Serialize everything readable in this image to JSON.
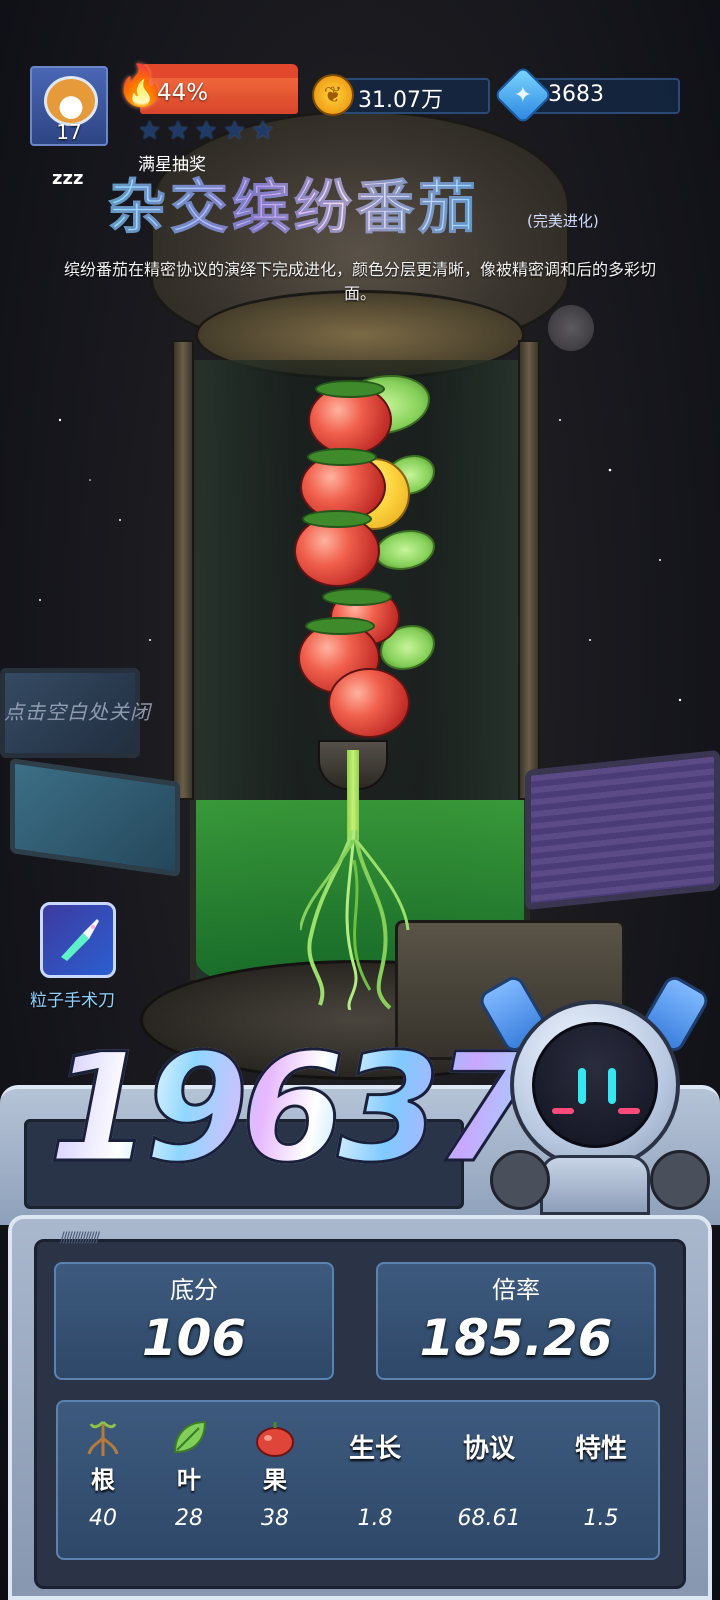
{
  "hud": {
    "avatar_level": "17",
    "status": "zzz",
    "energy_percent": "44%",
    "stars_filled": 0,
    "stars_total": 5,
    "coins": "31.07万",
    "gems": "3683",
    "icons": {
      "energy": "flame-icon",
      "coin": "coin-icon",
      "gem": "gem-icon",
      "star": "star-icon"
    }
  },
  "title": {
    "lottery_label": "满星抽奖",
    "name": "杂交缤纷番茄",
    "evolution": "(完美进化)",
    "description": "缤纷番茄在精密协议的演绎下完成进化，颜色分层更清晰，像被精密调和后的多彩切面。"
  },
  "close_hint": "点击空白处关闭",
  "tool": {
    "label": "粒子手术刀",
    "icon": "scalpel-icon"
  },
  "score": "19637",
  "stats": {
    "base_label": "底分",
    "base_value": "106",
    "multiplier_label": "倍率",
    "multiplier_value": "185.26"
  },
  "attributes": [
    {
      "label": "根",
      "value": "40",
      "icon": "root-icon"
    },
    {
      "label": "叶",
      "value": "28",
      "icon": "leaf-icon"
    },
    {
      "label": "果",
      "value": "38",
      "icon": "fruit-icon"
    },
    {
      "label": "生长",
      "value": "1.8"
    },
    {
      "label": "协议",
      "value": "68.61"
    },
    {
      "label": "特性",
      "value": "1.5"
    }
  ],
  "colors": {
    "energy": "#e2482b",
    "accent_blue": "#5b82b0",
    "panel": "#2b3447",
    "tool_label": "#8fd2ff"
  }
}
